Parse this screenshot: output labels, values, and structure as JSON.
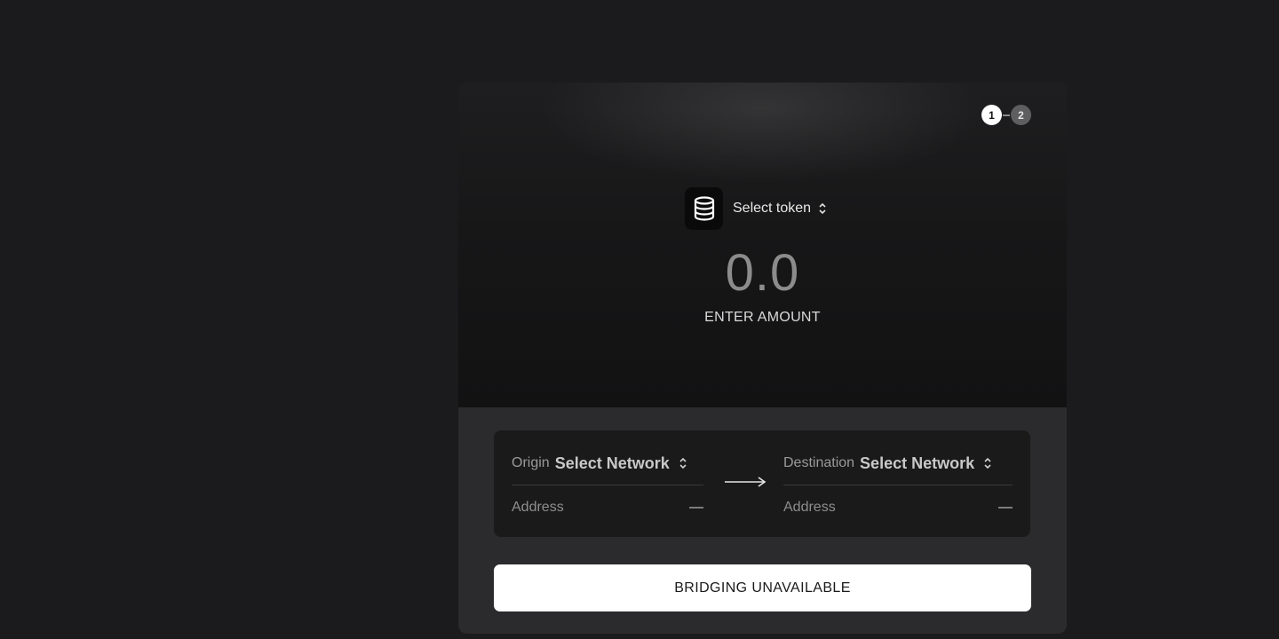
{
  "stepper": {
    "steps": [
      "1",
      "2"
    ],
    "active_step": 1
  },
  "token": {
    "label": "Select token",
    "icon": "coin-stack-icon"
  },
  "amount": {
    "value": "0.0",
    "label": "ENTER AMOUNT"
  },
  "origin": {
    "label": "Origin",
    "network": "Select Network",
    "address_label": "Address",
    "address_value": "—"
  },
  "destination": {
    "label": "Destination",
    "network": "Select Network",
    "address_label": "Address",
    "address_value": "—"
  },
  "action": {
    "label": "BRIDGING UNAVAILABLE"
  },
  "colors": {
    "page_background": "#1b1b1d",
    "card_lower": "#2b2b2d",
    "panel": "#1a1a1b",
    "button": "#ffffff",
    "step_active": "#ffffff",
    "step_inactive": "#5e5e60"
  }
}
